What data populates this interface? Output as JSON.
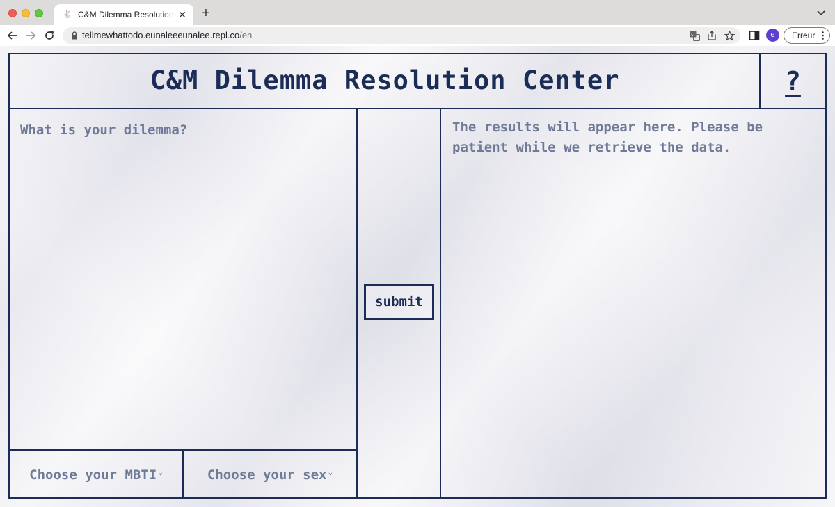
{
  "browser": {
    "tab_title": "C&M Dilemma Resolution Center",
    "url_host": "tellmewhattodo.eunaleeeunalee.repl.co",
    "url_path": "/en",
    "avatar_letter": "e",
    "profile_label": "Erreur"
  },
  "app": {
    "title": "C&M Dilemma Resolution Center",
    "help_label": "?",
    "dilemma_placeholder": "What is your dilemma?",
    "submit_label": "submit",
    "results_text": "The results will appear here. Please be patient while we retrieve the data.",
    "mbti_select_label": "Choose your MBTI",
    "sex_select_label": "Choose your sex"
  },
  "colors": {
    "ink": "#1b2d56",
    "muted_text": "#6e7a96"
  },
  "icons": {
    "tab_favicon": "rabbit-icon",
    "back": "arrow-left-icon",
    "forward": "arrow-right-icon",
    "reload": "reload-icon",
    "lock": "lock-icon",
    "translate": "translate-icon",
    "share": "share-icon",
    "bookmark": "star-icon",
    "side_panel": "side-panel-icon",
    "select_caret": "chevron-down-icon"
  }
}
